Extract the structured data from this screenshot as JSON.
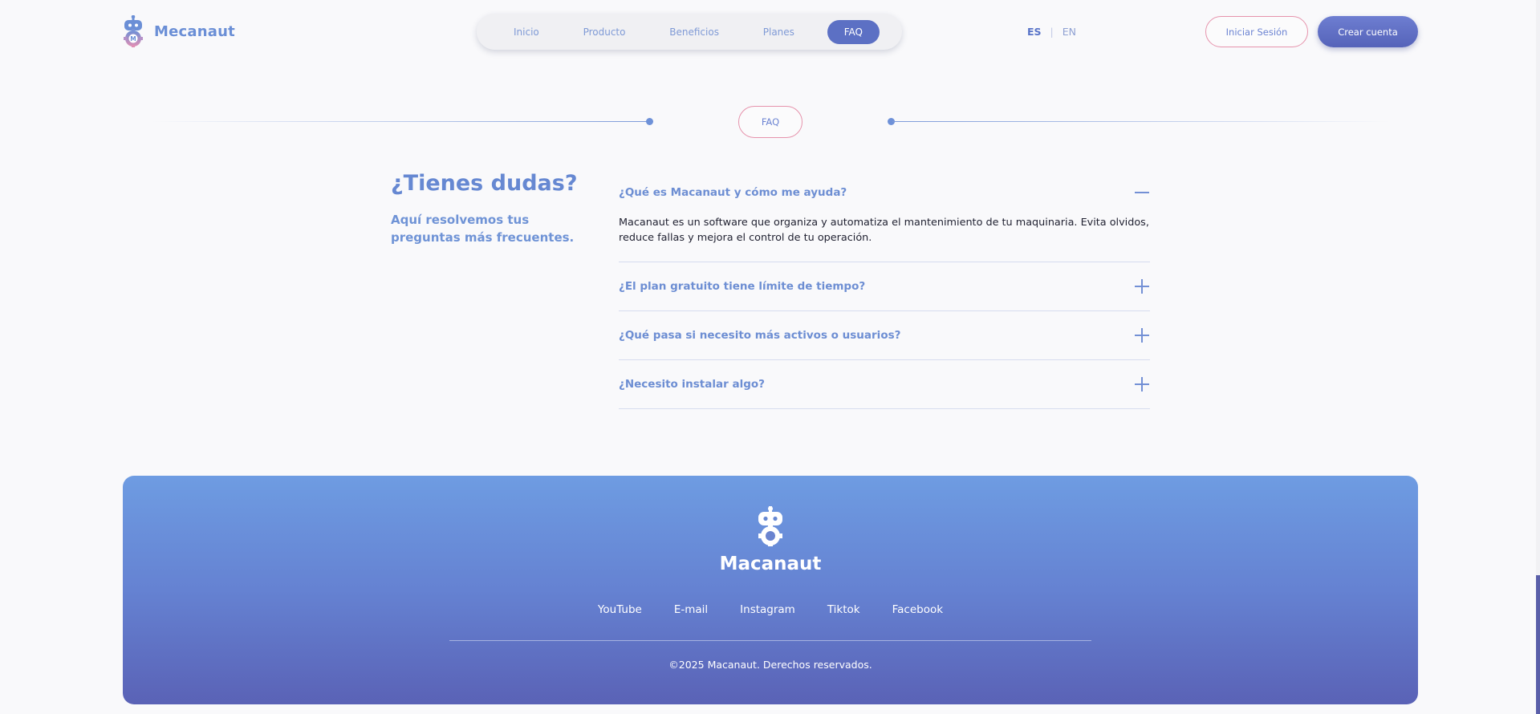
{
  "header": {
    "brand": "Mecanaut",
    "nav": [
      {
        "label": "Inicio",
        "active": false
      },
      {
        "label": "Producto",
        "active": false
      },
      {
        "label": "Beneficios",
        "active": false
      },
      {
        "label": "Planes",
        "active": false
      },
      {
        "label": "FAQ",
        "active": true
      }
    ],
    "languages": {
      "current": "ES",
      "separator": "|",
      "other": "EN"
    },
    "login_label": "Iniciar Sesión",
    "signup_label": "Crear cuenta"
  },
  "section_badge": "FAQ",
  "faq": {
    "title": "¿Tienes dudas?",
    "subtitle": "Aquí resolvemos tus preguntas más frecuentes.",
    "items": [
      {
        "question": "¿Qué es Macanaut y cómo me ayuda?",
        "answer": "Macanaut es un software que organiza y automatiza el mantenimiento de tu maquinaria. Evita olvidos, reduce fallas y mejora el control de tu operación.",
        "open": true
      },
      {
        "question": "¿El plan gratuito tiene límite de tiempo?",
        "open": false
      },
      {
        "question": "¿Qué pasa si necesito más activos o usuarios?",
        "open": false
      },
      {
        "question": "¿Necesito instalar algo?",
        "open": false
      }
    ]
  },
  "footer": {
    "brand": "Macanaut",
    "links": [
      "YouTube",
      "E-mail",
      "Instagram",
      "Tiktok",
      "Facebook"
    ],
    "copyright": "©2025 Macanaut. Derechos reservados."
  },
  "colors": {
    "accent": "#5c70c4",
    "brand_text": "#6b8fd6",
    "pink_outline": "#e693ac",
    "footer_top": "#6e9ce2",
    "footer_bottom": "#5a62b6"
  },
  "icons": {
    "logo": "robot-gear-icon",
    "faq_open": "minus-icon",
    "faq_closed": "plus-icon"
  }
}
